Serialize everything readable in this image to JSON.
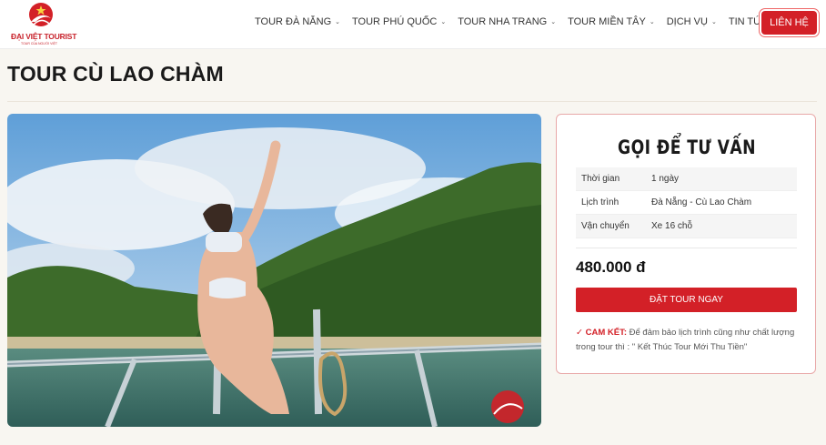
{
  "header": {
    "logo_text": "ĐẠI VIỆT TOURIST",
    "logo_sub": "TOUR CỦA NGƯỜI VIỆT",
    "nav": [
      {
        "label": "TOUR ĐÀ NẴNG"
      },
      {
        "label": "TOUR PHÚ QUỐC"
      },
      {
        "label": "TOUR NHA TRANG"
      },
      {
        "label": "TOUR MIỀN TÂY"
      },
      {
        "label": "DỊCH VỤ"
      },
      {
        "label": "TIN TỨC"
      }
    ],
    "contact_label": "LIÊN HỆ"
  },
  "page": {
    "title": "TOUR CÙ LAO CHÀM"
  },
  "card": {
    "title": "GỌI ĐỂ TƯ VẤN",
    "rows": [
      {
        "key": "Thời gian",
        "value": "1 ngày"
      },
      {
        "key": "Lịch trình",
        "value": "Đà Nẵng - Cù Lao Chàm"
      },
      {
        "key": "Vận chuyển",
        "value": "Xe 16 chỗ"
      }
    ],
    "price": "480.000 đ",
    "book_label": "ĐẶT TOUR NGAY",
    "commit_head": "✓ CAM KẾT:",
    "commit_text": " Để đảm bảo lịch trình cũng như chất lượng trong tour thì : \" Kết Thúc Tour Mới Thu Tiền\""
  },
  "colors": {
    "brand_red": "#d32027",
    "page_bg": "#f8f6f1"
  }
}
